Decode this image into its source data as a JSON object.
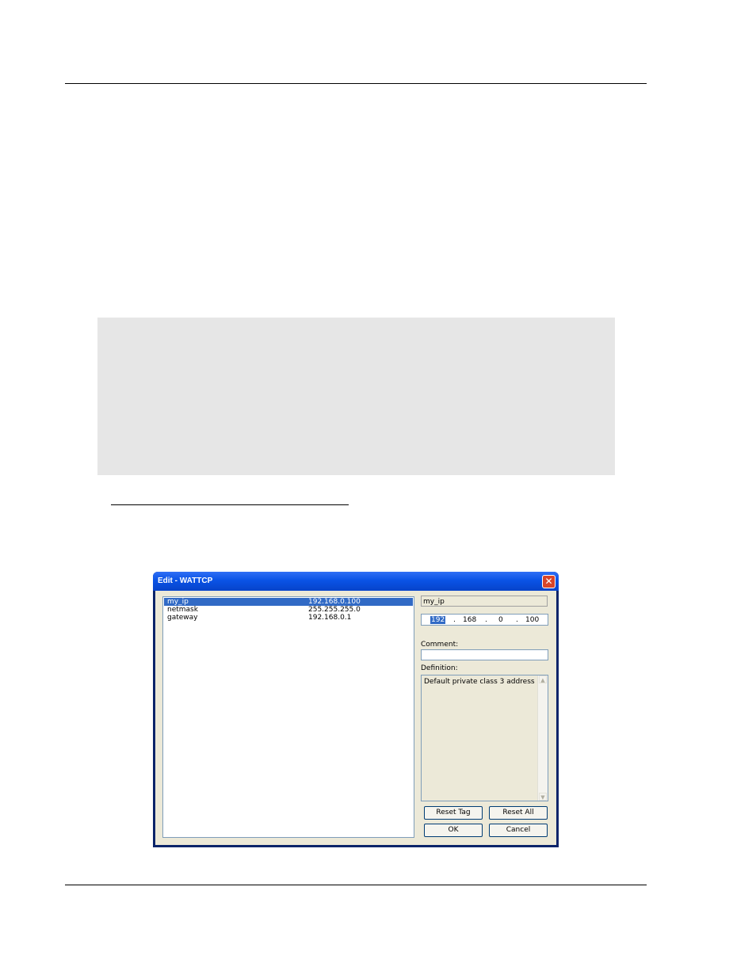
{
  "dialog": {
    "title": "Edit - WATTCP",
    "close_glyph": "✕",
    "list": [
      {
        "name": "my_ip",
        "value": "192.168.0.100",
        "selected": true
      },
      {
        "name": "netmask",
        "value": "255.255.255.0",
        "selected": false
      },
      {
        "name": "gateway",
        "value": "192.168.0.1",
        "selected": false
      }
    ],
    "tag_name": "my_ip",
    "ip": {
      "o1": "192",
      "o2": "168",
      "o3": "0",
      "o4": "100",
      "dot": "."
    },
    "comment_label": "Comment:",
    "comment_value": "",
    "definition_label": "Definition:",
    "definition_text": "Default private class 3 address",
    "buttons": {
      "reset_tag": "Reset Tag",
      "reset_all": "Reset All",
      "ok": "OK",
      "cancel": "Cancel"
    },
    "scroll_up": "▲",
    "scroll_down": "▼"
  },
  "colors": {
    "titlebar": "#0a53e6",
    "selection": "#316ac5",
    "panel": "#e6e6e6",
    "dialog_bg": "#ece9d8"
  }
}
